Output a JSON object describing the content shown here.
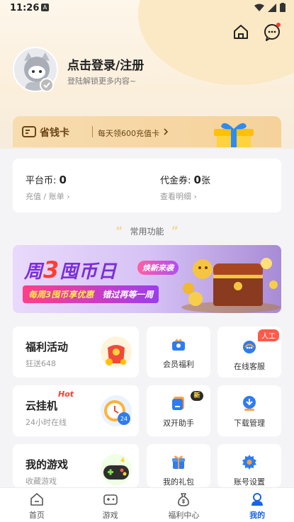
{
  "status_bar": {
    "time": "11:26",
    "notif_letter": "A"
  },
  "profile": {
    "login_title": "点击登录/注册",
    "login_sub": "登陆解锁更多内容~"
  },
  "saver_card": {
    "title": "省钱卡",
    "sub": "每天领600充值卡"
  },
  "balance": {
    "platform_coin_label": "平台币:",
    "platform_coin_value": "0",
    "platform_coin_link": "充值 / 账单",
    "voucher_label": "代金券:",
    "voucher_value": "0",
    "voucher_unit": "张",
    "voucher_link": "查看明细"
  },
  "section": {
    "common_title": "常用功能"
  },
  "banner": {
    "title_pre": "周",
    "title_num": "3",
    "title_post": "囤币日",
    "tag": "焕新来袭",
    "strip_a": "每周3囤币享优惠",
    "strip_b": "错过再等一周"
  },
  "functions": {
    "welfare": {
      "title": "福利活动",
      "sub": "狂送648"
    },
    "member": {
      "label": "会员福利"
    },
    "service": {
      "label": "在线客服",
      "badge": "人工"
    },
    "cloud": {
      "title": "云挂机",
      "sub": "24小时在线",
      "hot": "Hot"
    },
    "dual": {
      "label": "双开助手",
      "badge": "新"
    },
    "download": {
      "label": "下载管理"
    },
    "mygames": {
      "title": "我的游戏",
      "sub": "收藏游戏"
    },
    "gifts": {
      "label": "我的礼包"
    },
    "account": {
      "label": "账号设置"
    }
  },
  "tabs": [
    {
      "label": "首页"
    },
    {
      "label": "游戏"
    },
    {
      "label": "福利中心"
    },
    {
      "label": "我的"
    }
  ],
  "colors": {
    "accent": "#1a63e8",
    "brand_gold": "#f5d29a",
    "banner_purple": "#7b2ed8"
  }
}
